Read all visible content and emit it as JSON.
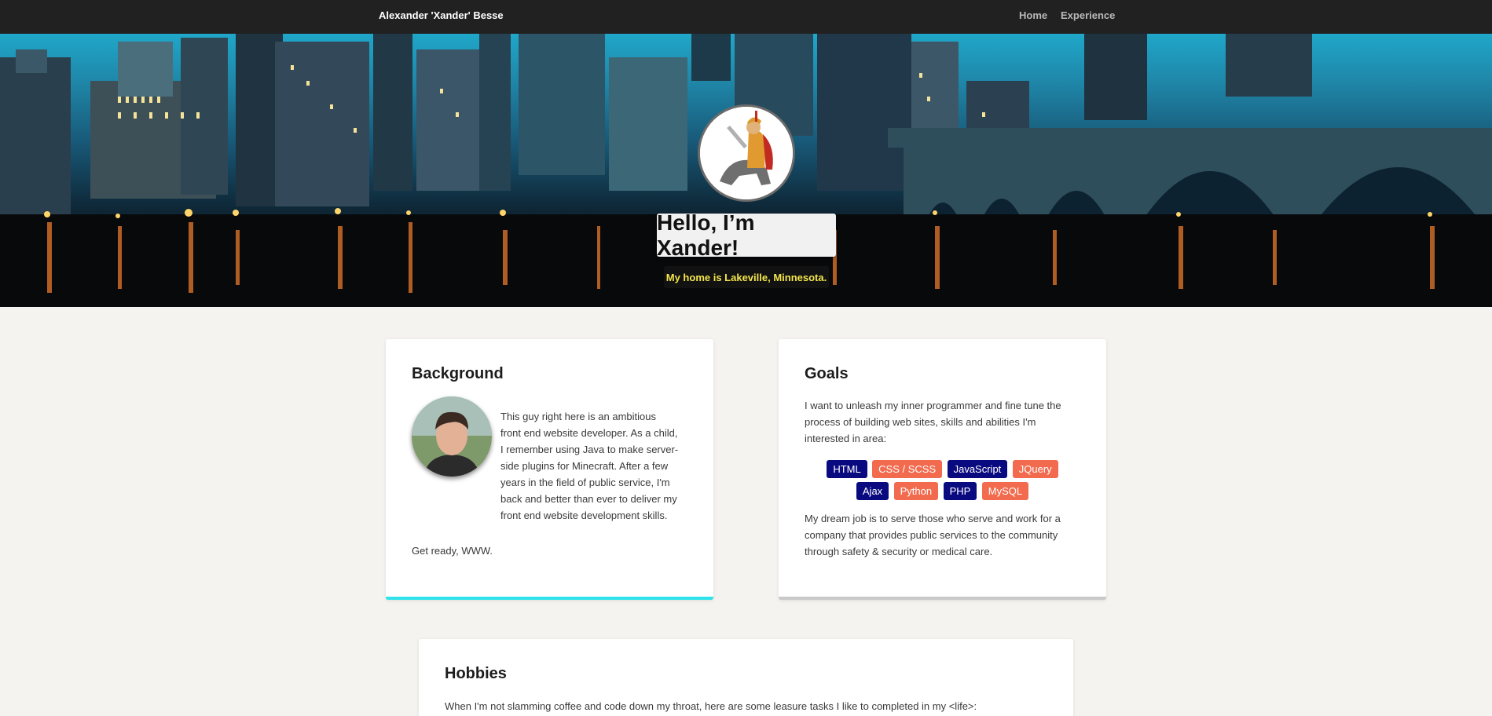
{
  "navbar": {
    "brand": "Alexander 'Xander' Besse",
    "links": [
      "Home",
      "Experience"
    ]
  },
  "hero": {
    "title": "Hello, I’m Xander!",
    "subtitle": "My home is Lakeville, Minnesota.",
    "subtitle_color": "#f4e64b"
  },
  "background": {
    "heading": "Background",
    "text": "This guy right here is an ambitious front end website developer. As a child, I remember using Java to make server-side plugins for Minecraft. After a few years in the field of public service, I'm back and better than ever to deliver my front end website development skills.",
    "closing": "Get ready, WWW.",
    "accent": "#2ee3ea"
  },
  "goals": {
    "heading": "Goals",
    "intro": "I want to unleash my inner programmer and fine tune the process of building web sites, skills and abilities I'm interested in area:",
    "tags": [
      {
        "label": "HTML",
        "color": "navy"
      },
      {
        "label": "CSS / SCSS",
        "color": "coral"
      },
      {
        "label": "JavaScript",
        "color": "navy"
      },
      {
        "label": "JQuery",
        "color": "coral"
      },
      {
        "label": "Ajax",
        "color": "navy"
      },
      {
        "label": "Python",
        "color": "coral"
      },
      {
        "label": "PHP",
        "color": "navy"
      },
      {
        "label": "MySQL",
        "color": "coral"
      }
    ],
    "dream": "My dream job is to serve those who serve and work for a company that provides public services to the community through safety & security or medical care."
  },
  "hobbies": {
    "heading": "Hobbies",
    "intro": "When I'm not slamming coffee and code down my throat, here are some leasure tasks I like to completed in my <life>:"
  },
  "colors": {
    "navbar": "#212121",
    "page_bg": "#f5f3ef",
    "tag_navy": "#0a0a80",
    "tag_coral": "#f26b4f"
  }
}
